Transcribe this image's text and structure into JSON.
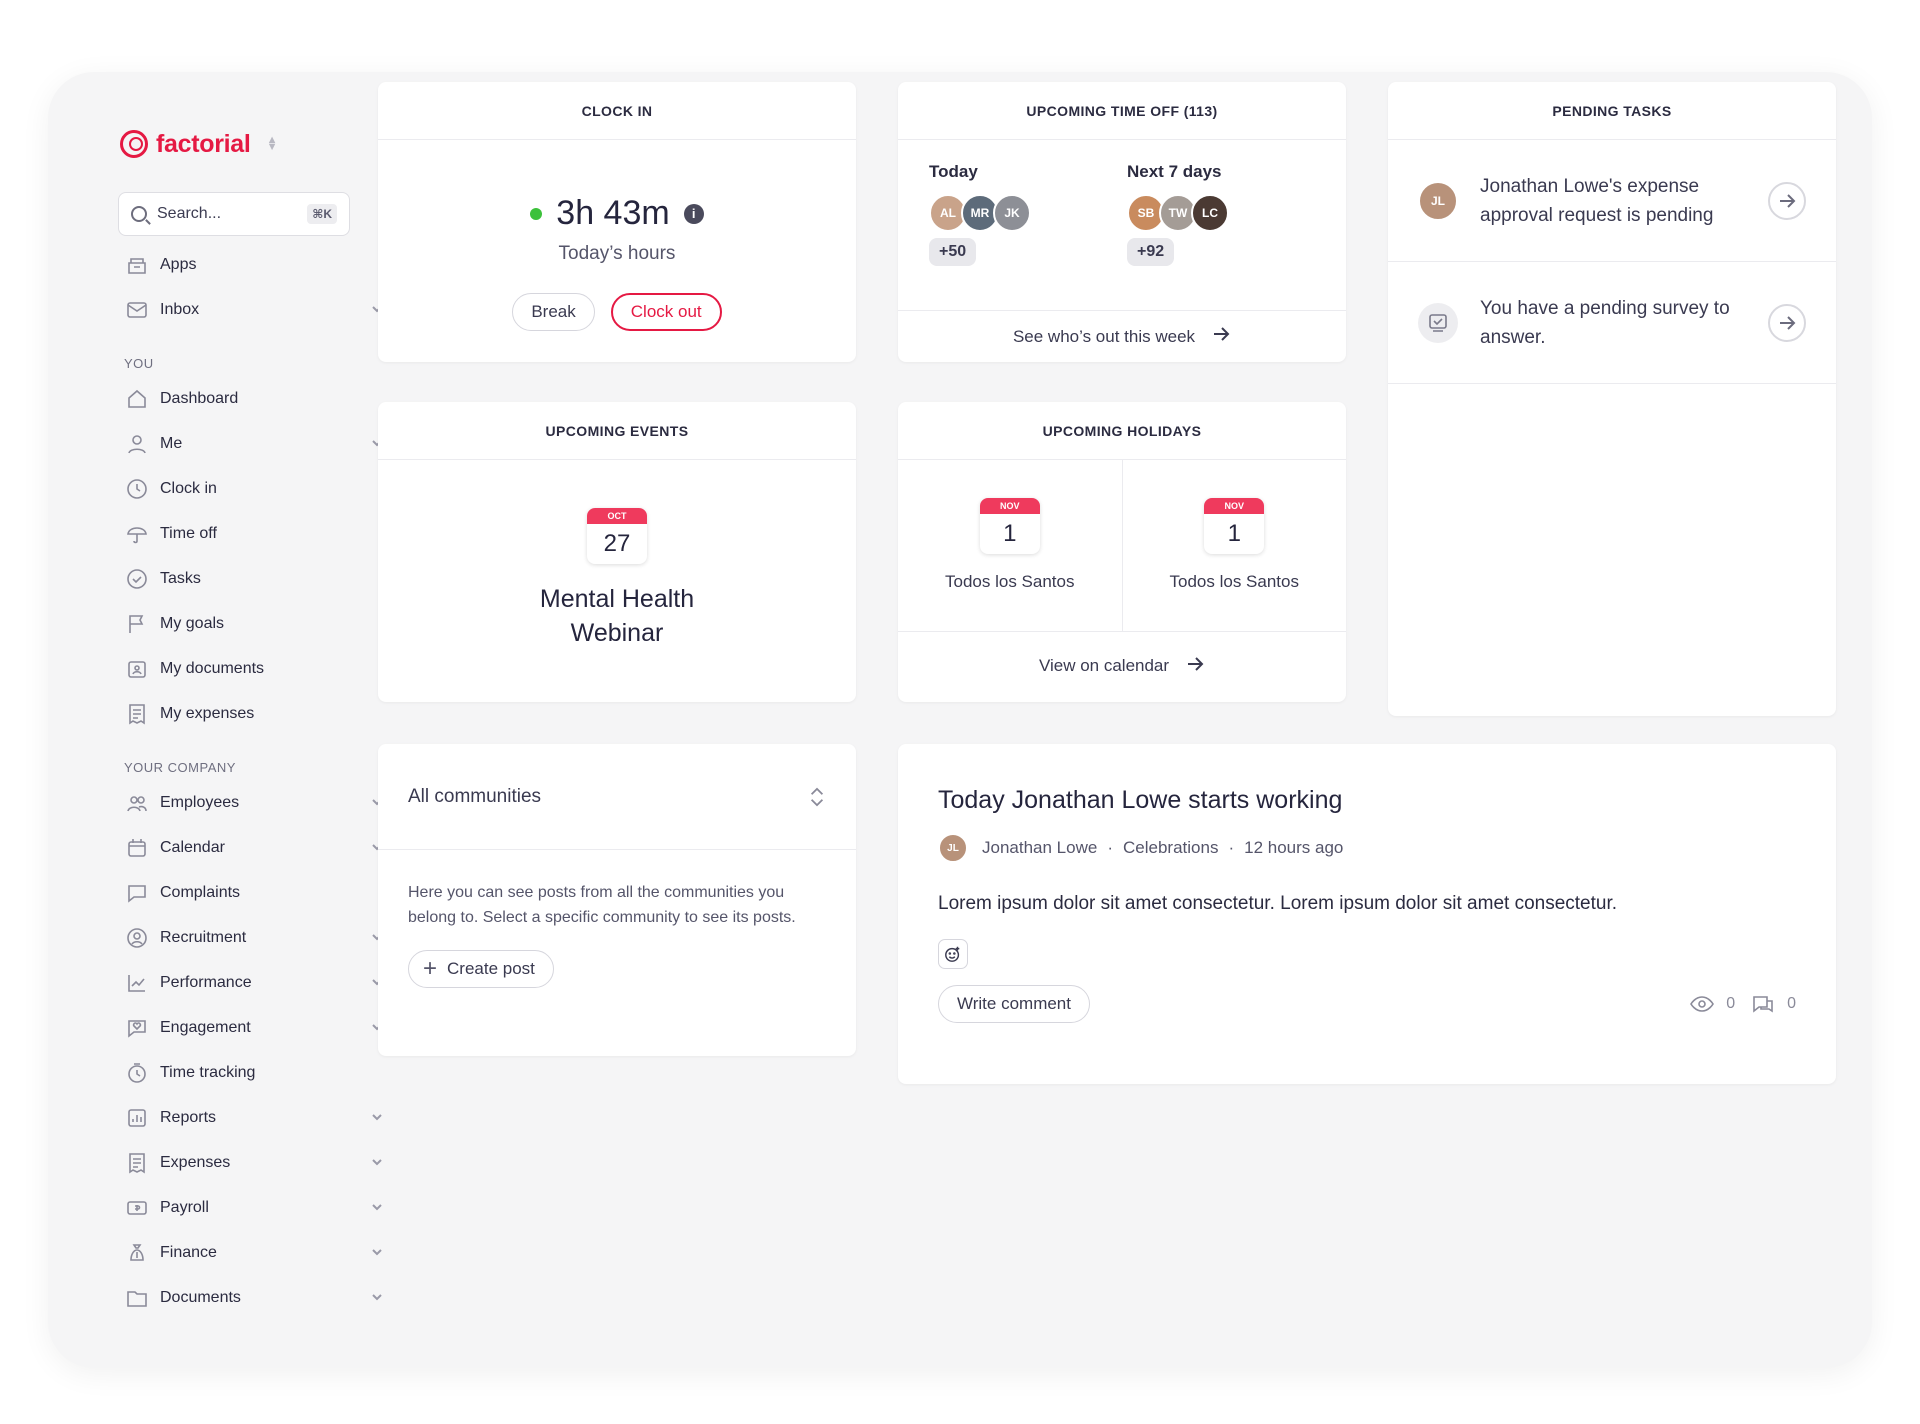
{
  "app": {
    "name": "factorial"
  },
  "search": {
    "placeholder": "Search...",
    "shortcut": "⌘K"
  },
  "nav": {
    "top": [
      {
        "label": "Apps",
        "icon": "apps-icon",
        "chevron": false
      },
      {
        "label": "Inbox",
        "icon": "inbox-icon",
        "chevron": true
      }
    ],
    "you_label": "YOU",
    "you": [
      {
        "label": "Dashboard",
        "icon": "home-icon",
        "chevron": false
      },
      {
        "label": "Me",
        "icon": "user-icon",
        "chevron": true
      },
      {
        "label": "Clock in",
        "icon": "clock-icon",
        "chevron": false
      },
      {
        "label": "Time off",
        "icon": "umbrella-icon",
        "chevron": false
      },
      {
        "label": "Tasks",
        "icon": "check-circle-icon",
        "chevron": false
      },
      {
        "label": "My goals",
        "icon": "flag-icon",
        "chevron": false
      },
      {
        "label": "My documents",
        "icon": "document-icon",
        "chevron": false
      },
      {
        "label": "My expenses",
        "icon": "receipt-icon",
        "chevron": false
      }
    ],
    "company_label": "YOUR COMPANY",
    "company": [
      {
        "label": "Employees",
        "icon": "people-icon",
        "chevron": true
      },
      {
        "label": "Calendar",
        "icon": "calendar-icon",
        "chevron": true
      },
      {
        "label": "Complaints",
        "icon": "chat-icon",
        "chevron": false
      },
      {
        "label": "Recruitment",
        "icon": "recruit-icon",
        "chevron": true
      },
      {
        "label": "Performance",
        "icon": "chart-icon",
        "chevron": true
      },
      {
        "label": "Engagement",
        "icon": "heart-chat-icon",
        "chevron": true
      },
      {
        "label": "Time tracking",
        "icon": "timer-icon",
        "chevron": false
      },
      {
        "label": "Reports",
        "icon": "reports-icon",
        "chevron": true
      },
      {
        "label": "Expenses",
        "icon": "receipt-icon",
        "chevron": true
      },
      {
        "label": "Payroll",
        "icon": "payroll-icon",
        "chevron": true
      },
      {
        "label": "Finance",
        "icon": "money-bag-icon",
        "chevron": true
      },
      {
        "label": "Documents",
        "icon": "folder-icon",
        "chevron": true
      }
    ]
  },
  "clock_in": {
    "title": "CLOCK IN",
    "hours": "3h 43m",
    "subtitle": "Today’s hours",
    "break_label": "Break",
    "clock_out_label": "Clock out"
  },
  "time_off": {
    "title": "UPCOMING TIME OFF (113)",
    "today_label": "Today",
    "today_more": "+50",
    "next_label": "Next 7 days",
    "next_more": "+92",
    "link": "See who’s out this week"
  },
  "tasks": {
    "title": "PENDING TASKS",
    "items": [
      {
        "text": "Jonathan Lowe's expense approval request is pending",
        "icon": "avatar"
      },
      {
        "text": "You have a pending survey to answer.",
        "icon": "survey-icon"
      }
    ]
  },
  "events": {
    "title": "UPCOMING EVENTS",
    "month": "OCT",
    "day": "27",
    "name": "Mental Health Webinar"
  },
  "holidays": {
    "title": "UPCOMING HOLIDAYS",
    "items": [
      {
        "month": "NOV",
        "day": "1",
        "name": "Todos los Santos"
      },
      {
        "month": "NOV",
        "day": "1",
        "name": "Todos los Santos"
      }
    ],
    "link": "View on calendar"
  },
  "communities": {
    "selector": "All communities",
    "description": "Here you can see posts from all the communities you belong to. Select a specific community to see its posts.",
    "create_label": "Create post"
  },
  "post": {
    "title": "Today Jonathan Lowe starts working",
    "author": "Jonathan Lowe",
    "community": "Celebrations",
    "time": "12 hours ago",
    "body": "Lorem ipsum dolor sit amet consectetur. Lorem ipsum dolor sit amet consectetur.",
    "comment_label": "Write comment",
    "views": "0",
    "comments": "0"
  },
  "colors": {
    "brand": "#e51943",
    "online": "#3cc13b"
  }
}
